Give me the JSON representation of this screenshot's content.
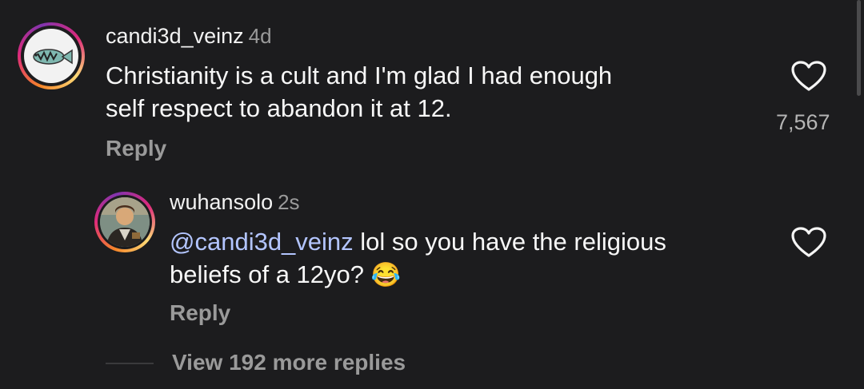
{
  "comment": {
    "username": "candi3d_veinz",
    "time": "4d",
    "text_line1": "Christianity is a cult and I'm glad I had enough",
    "text_line2": "self respect to abandon it at 12.",
    "reply_label": "Reply",
    "like_count": "7,567"
  },
  "reply": {
    "username": "wuhansolo",
    "time": "2s",
    "mention": "@candi3d_veinz",
    "text_line1_rest": " lol so you have the religious",
    "text_line2": "beliefs of a 12yo?",
    "emoji": "😂",
    "reply_label": "Reply"
  },
  "view_more": "View 192 more replies",
  "icons": {
    "like": "heart-outline-icon",
    "avatar1": "fish-icon",
    "avatar2": "person-avatar"
  },
  "colors": {
    "background": "#1c1c1e",
    "mention": "#b3c5ff",
    "secondary_text": "#9a9a9a"
  }
}
